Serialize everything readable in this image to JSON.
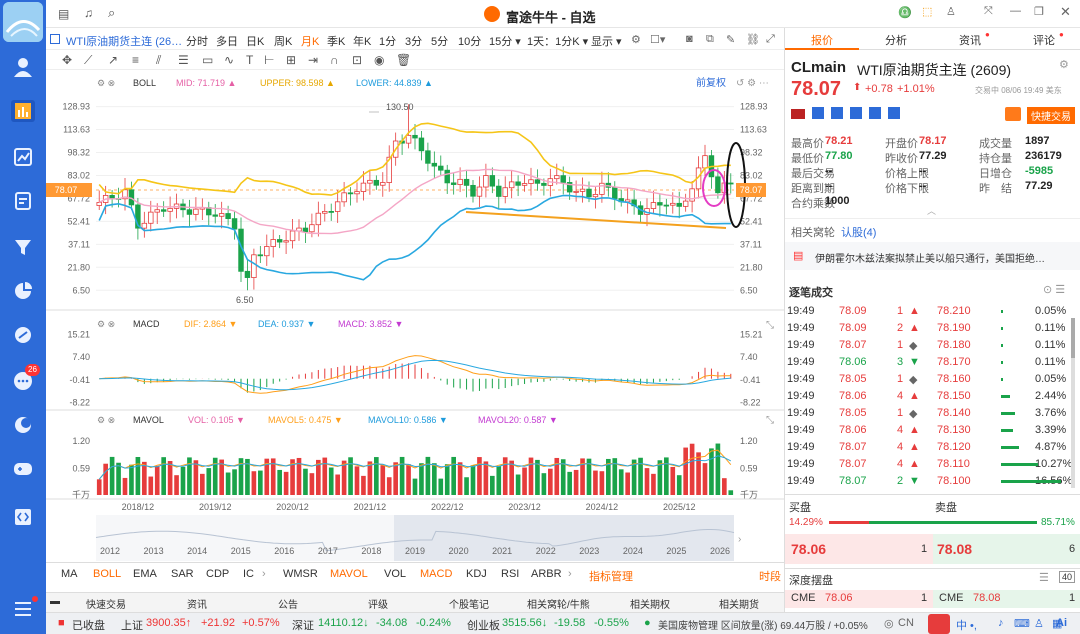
{
  "sidebar": {
    "logo": "",
    "badge": "26"
  },
  "titlebar": {
    "title": "富途牛牛 - 自选"
  },
  "toolbar": {
    "instrument": "WTI原油期货主连 (26…",
    "periods": [
      "分时",
      "多日",
      "日K",
      "周K",
      "月K",
      "季K",
      "年K",
      "1分",
      "3分",
      "5分",
      "10分",
      "15分 ▾",
      "1天：1分K ▾",
      "显示 ▾"
    ],
    "active_period": "月K"
  },
  "boll": {
    "label": "BOLL",
    "mid": "MID: 71.719 ▲",
    "upper": "UPPER: 98.598 ▲",
    "lower": "LOWER: 44.839 ▲",
    "adjust": "前复权",
    "yticks": [
      "128.93",
      "113.63",
      "98.32",
      "83.02",
      "67.72",
      "52.41",
      "37.11",
      "21.80",
      "6.50"
    ],
    "high_label": "130.50",
    "low_label": "6.50",
    "price_tag": "78.07"
  },
  "macd": {
    "label": "MACD",
    "dif": "DIF: 2.864 ▼",
    "dea": "DEA: 0.937 ▼",
    "macd": "MACD: 3.852 ▼",
    "yticks": [
      "15.21",
      "7.40",
      "-0.41",
      "-8.22"
    ]
  },
  "mavol": {
    "label": "MAVOL",
    "vol": "VOL: 0.105 ▼",
    "mavol5": "MAVOL5: 0.475 ▼",
    "mavol10": "MAVOL10: 0.586 ▼",
    "mavol20": "MAVOL20: 0.587 ▼",
    "yticks": [
      "1.20",
      "0.59",
      "千万"
    ]
  },
  "xaxis": {
    "main": [
      "2018/12",
      "2019/12",
      "2020/12",
      "2021/12",
      "2022/12",
      "2023/12",
      "2024/12",
      "2025/12"
    ],
    "nav": [
      "2012",
      "2013",
      "2014",
      "2015",
      "2016",
      "2017",
      "2018",
      "2019",
      "2020",
      "2021",
      "2022",
      "2023",
      "2024",
      "2025",
      "2026"
    ]
  },
  "indicators": {
    "items": [
      "MA",
      "BOLL",
      "EMA",
      "SAR",
      "CDP",
      "IC",
      "WMSR",
      "MAVOL",
      "VOL",
      "MACD",
      "KDJ",
      "RSI",
      "ARBR"
    ],
    "manage": "指标管理",
    "timeframe": "时段"
  },
  "bottom_tabs": [
    "快速交易",
    "资讯",
    "公告",
    "评级",
    "个股笔记",
    "相关窝轮/牛熊",
    "相关期权",
    "相关期货"
  ],
  "right": {
    "tabs": [
      "报价",
      "分析",
      "资讯",
      "评论"
    ],
    "code": "CLmain",
    "name": "WTI原油期货主连 (2609)",
    "price": "78.07",
    "change": "+0.78",
    "pct": "+1.01%",
    "status": "交易中 08/06 19:49 美东",
    "fast_trade": "快捷交易",
    "stats": [
      [
        "最高价",
        "78.21",
        "开盘价",
        "78.17",
        "成交量",
        "1897"
      ],
      [
        "最低价",
        "77.80",
        "昨收价",
        "77.29",
        "持仓量",
        "236179"
      ],
      [
        "最后交易",
        "--",
        "价格上限",
        "--",
        "日增仓",
        "-5985"
      ],
      [
        "距离到期",
        "--",
        "价格下限",
        "--",
        "昨　结",
        "77.29"
      ],
      [
        "合约乘数",
        "1000",
        "",
        "",
        "",
        ""
      ]
    ],
    "related_label": "相关窝轮",
    "related_link": "认股(4)",
    "news": "伊朗霍尔木兹法案拟禁止美以船只通行，美国拒绝…",
    "trades_title": "逐笔成交",
    "trades": [
      [
        "19:49",
        "78.09",
        "1",
        "▲",
        "78.210",
        "0.05%"
      ],
      [
        "19:49",
        "78.09",
        "2",
        "▲",
        "78.190",
        "0.11%"
      ],
      [
        "19:49",
        "78.07",
        "1",
        "◆",
        "78.180",
        "0.11%"
      ],
      [
        "19:49",
        "78.06",
        "3",
        "▼",
        "78.170",
        "0.11%"
      ],
      [
        "19:49",
        "78.05",
        "1",
        "◆",
        "78.160",
        "0.05%"
      ],
      [
        "19:49",
        "78.06",
        "4",
        "▲",
        "78.150",
        "2.44%"
      ],
      [
        "19:49",
        "78.05",
        "1",
        "◆",
        "78.140",
        "3.76%"
      ],
      [
        "19:49",
        "78.06",
        "4",
        "▲",
        "78.130",
        "3.39%"
      ],
      [
        "19:49",
        "78.07",
        "4",
        "▲",
        "78.120",
        "4.87%"
      ],
      [
        "19:49",
        "78.07",
        "4",
        "▲",
        "78.110",
        "10.27%"
      ],
      [
        "19:49",
        "78.07",
        "2",
        "▼",
        "78.100",
        "16.56%"
      ]
    ],
    "buy_label": "买盘",
    "sell_label": "卖盘",
    "buy_pct": "14.29%",
    "sell_pct": "85.71%",
    "bid": "78.06",
    "bid_qty": "1",
    "ask": "78.08",
    "ask_qty": "6",
    "depth_title": "深度摆盘",
    "depth_count": "40",
    "depth_bid": [
      "CME",
      "78.06",
      "1"
    ],
    "depth_ask": [
      "CME",
      "78.08",
      "1"
    ]
  },
  "status": {
    "closed": "已收盘",
    "idx": [
      [
        "上证",
        "3900.35↑",
        "+21.92",
        "+0.57%"
      ],
      [
        "深证",
        "14110.12↓",
        "-34.08",
        "-0.24%"
      ],
      [
        "创业板",
        "3515.56↓",
        "-19.58",
        "-0.55%"
      ]
    ],
    "ticker": "美国废物管理  区间放量(涨) 69.44万股 / +0.05%",
    "region": "CN"
  }
}
